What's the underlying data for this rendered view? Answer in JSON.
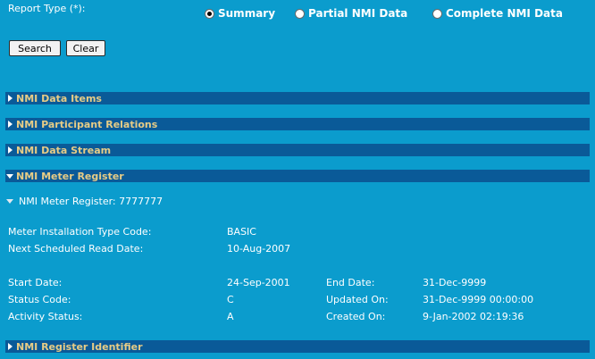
{
  "report_type": {
    "label": "Report Type (*):",
    "options": [
      {
        "label": "Summary",
        "selected": true
      },
      {
        "label": "Partial NMI Data",
        "selected": false
      },
      {
        "label": "Complete NMI Data",
        "selected": false
      }
    ]
  },
  "buttons": {
    "search": "Search",
    "clear": "Clear"
  },
  "sections": [
    {
      "title": "NMI Data Items",
      "expanded": false
    },
    {
      "title": "NMI Participant Relations",
      "expanded": false
    },
    {
      "title": "NMI Data Stream",
      "expanded": false
    },
    {
      "title": "NMI Meter Register",
      "expanded": true
    },
    {
      "title": "NMI Register Identifier",
      "expanded": false
    }
  ],
  "meter_register": {
    "sub_title": "NMI Meter Register: 7777777",
    "installation_type_label": "Meter Installation Type Code:",
    "installation_type_value": "BASIC",
    "next_read_label": "Next Scheduled Read Date:",
    "next_read_value": "10-Aug-2007",
    "start_date_label": "Start Date:",
    "start_date_value": "24-Sep-2001",
    "end_date_label": "End Date:",
    "end_date_value": "31-Dec-9999",
    "status_code_label": "Status Code:",
    "status_code_value": "C",
    "updated_on_label": "Updated On:",
    "updated_on_value": "31-Dec-9999 00:00:00",
    "activity_status_label": "Activity Status:",
    "activity_status_value": "A",
    "created_on_label": "Created On:",
    "created_on_value": "9-Jan-2002 02:19:36"
  },
  "colors": {
    "background": "#0b9ccd",
    "section_bar": "#0a5a98",
    "section_title": "#e7cc86"
  }
}
